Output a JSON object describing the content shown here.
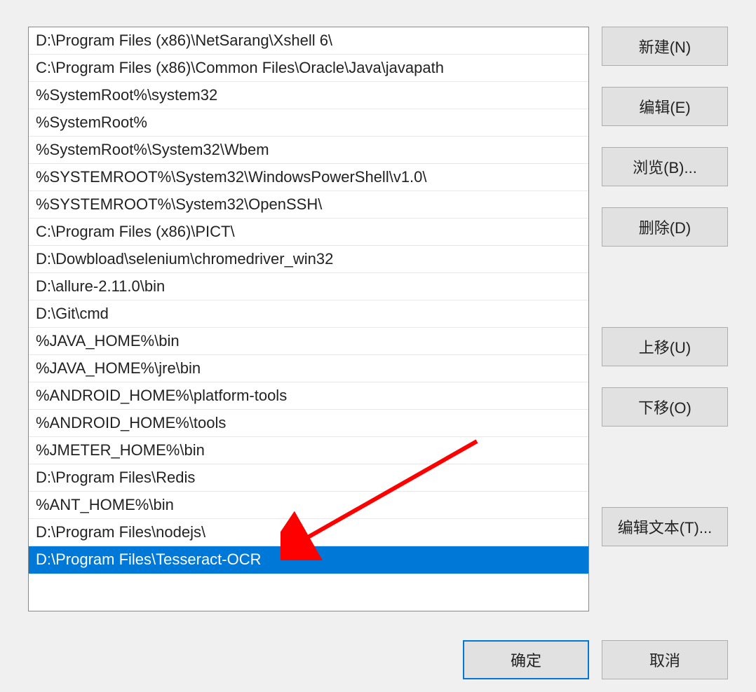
{
  "paths": [
    {
      "text": "D:\\Program Files (x86)\\NetSarang\\Xshell 6\\",
      "selected": false
    },
    {
      "text": "C:\\Program Files (x86)\\Common Files\\Oracle\\Java\\javapath",
      "selected": false
    },
    {
      "text": "%SystemRoot%\\system32",
      "selected": false
    },
    {
      "text": "%SystemRoot%",
      "selected": false
    },
    {
      "text": "%SystemRoot%\\System32\\Wbem",
      "selected": false
    },
    {
      "text": "%SYSTEMROOT%\\System32\\WindowsPowerShell\\v1.0\\",
      "selected": false
    },
    {
      "text": "%SYSTEMROOT%\\System32\\OpenSSH\\",
      "selected": false
    },
    {
      "text": "C:\\Program Files (x86)\\PICT\\",
      "selected": false
    },
    {
      "text": "D:\\Dowbload\\selenium\\chromedriver_win32",
      "selected": false
    },
    {
      "text": "D:\\allure-2.11.0\\bin",
      "selected": false
    },
    {
      "text": "D:\\Git\\cmd",
      "selected": false
    },
    {
      "text": "%JAVA_HOME%\\bin",
      "selected": false
    },
    {
      "text": "%JAVA_HOME%\\jre\\bin",
      "selected": false
    },
    {
      "text": "%ANDROID_HOME%\\platform-tools",
      "selected": false
    },
    {
      "text": "%ANDROID_HOME%\\tools",
      "selected": false
    },
    {
      "text": "%JMETER_HOME%\\bin",
      "selected": false
    },
    {
      "text": "D:\\Program Files\\Redis",
      "selected": false
    },
    {
      "text": "%ANT_HOME%\\bin",
      "selected": false
    },
    {
      "text": "D:\\Program Files\\nodejs\\",
      "selected": false
    },
    {
      "text": "D:\\Program Files\\Tesseract-OCR",
      "selected": true
    }
  ],
  "buttons": {
    "new": "新建(N)",
    "edit": "编辑(E)",
    "browse": "浏览(B)...",
    "delete": "删除(D)",
    "moveUp": "上移(U)",
    "moveDown": "下移(O)",
    "editText": "编辑文本(T)...",
    "ok": "确定",
    "cancel": "取消"
  }
}
